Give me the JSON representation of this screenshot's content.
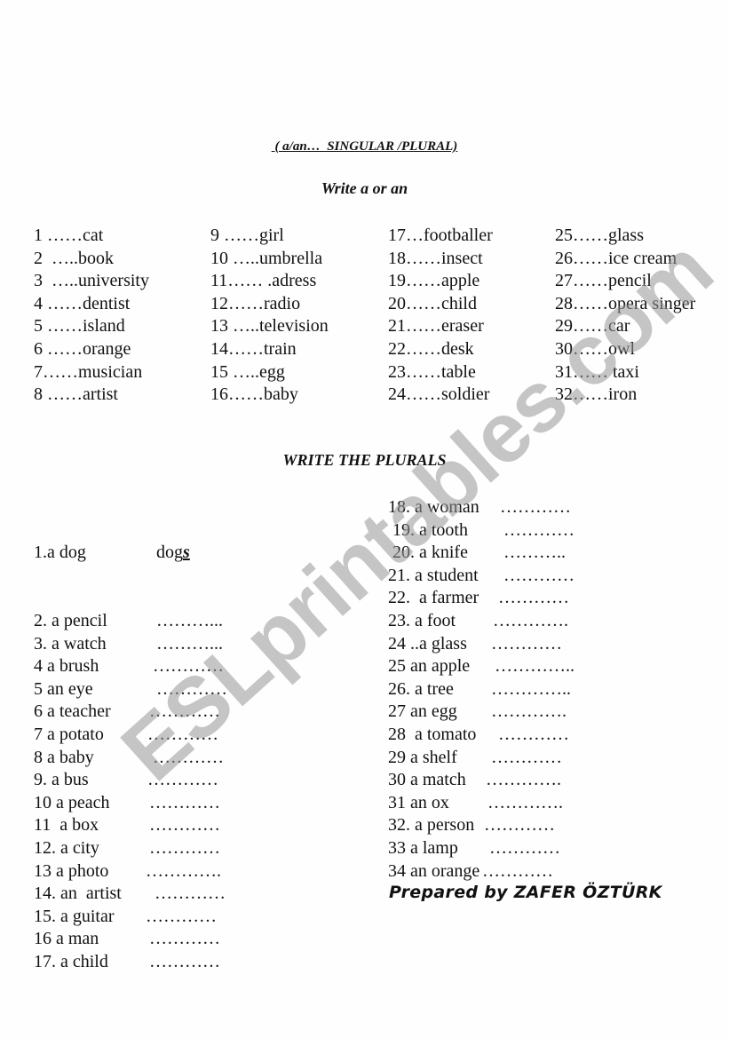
{
  "header": {
    "title": " ( a/an…  SINGULAR /PLURAL)",
    "instruction": "Write a or an"
  },
  "exercise1": {
    "columns": [
      [
        "1 ……cat",
        "2  …..book",
        "3  …..university",
        "4 ……dentist",
        "5 ……island",
        "6 ……orange",
        "7……musician",
        "8 ……artist"
      ],
      [
        "9 ……girl",
        "10 …..umbrella",
        "11…… .adress",
        "12……radio",
        "13 …..television",
        "14……train",
        "15 …..egg",
        "16……baby"
      ],
      [
        "17…footballer",
        "18……insect",
        "19……apple",
        "20……child",
        "21……eraser",
        "22……desk",
        "23……table",
        "24……soldier"
      ],
      [
        "25……glass",
        "26……ice cream",
        "27……pencil",
        "28……opera singer",
        "29……car",
        "30……owl",
        "31…… taxi",
        "32……iron"
      ]
    ]
  },
  "exercise2": {
    "title": "WRITE THE PLURALS",
    "example": {
      "word": "1.a dog",
      "answer_stem": "dog",
      "answer_suffix": "s"
    },
    "left": [
      {
        "word": "2. a pencil",
        "blank": "………..."
      },
      {
        "word": "3. a watch",
        "blank": "………..."
      },
      {
        "word": "4 a brush",
        "blank": "…………"
      },
      {
        "word": "5 an eye",
        "blank": "…………"
      },
      {
        "word": "6 a teacher",
        "blank": "…………"
      },
      {
        "word": "7 a potato",
        "blank": "…………"
      },
      {
        "word": "8 a baby",
        "blank": "…………"
      },
      {
        "word": "9. a bus",
        "blank": "…………"
      },
      {
        "word": "10 a peach",
        "blank": "…………"
      },
      {
        "word": "11  a box",
        "blank": "…………"
      },
      {
        "word": "12. a city",
        "blank": "…………"
      },
      {
        "word": "13 a photo",
        "blank": "…………."
      },
      {
        "word": "14. an  artist",
        "blank": "…………"
      },
      {
        "word": "15. a guitar",
        "blank": "…………"
      },
      {
        "word": "16 a man",
        "blank": "…………"
      },
      {
        "word": "17. a child",
        "blank": "…………"
      }
    ],
    "right": [
      {
        "word": "18. a woman",
        "blank": "…………"
      },
      {
        "word": " 19. a tooth",
        "blank": "…………"
      },
      {
        "word": " 20. a knife",
        "blank": "……….."
      },
      {
        "word": "21. a student",
        "blank": "…………"
      },
      {
        "word": "22.  a farmer",
        "blank": "…………"
      },
      {
        "word": "23. a foot",
        "blank": "…………."
      },
      {
        "word": "24 ..a glass",
        "blank": "…………"
      },
      {
        "word": "25 an apple",
        "blank": "………….."
      },
      {
        "word": "26. a tree",
        "blank": "………….."
      },
      {
        "word": "27 an egg",
        "blank": "…………."
      },
      {
        "word": "28  a tomato",
        "blank": "…………"
      },
      {
        "word": "29 a shelf",
        "blank": "…………"
      },
      {
        "word": "30 a match",
        "blank": "…………."
      },
      {
        "word": "31 an ox",
        "blank": "…………."
      },
      {
        "word": "32. a person",
        "blank": "…………"
      },
      {
        "word": "33 a lamp",
        "blank": "…………"
      },
      {
        "word": "34 an orange",
        "blank": "…………"
      }
    ]
  },
  "footer": {
    "author": "Prepared by ZAFER ÖZTÜRK"
  },
  "watermark": {
    "text": "ESLprintables.com",
    "color": "#a0a0a0"
  }
}
